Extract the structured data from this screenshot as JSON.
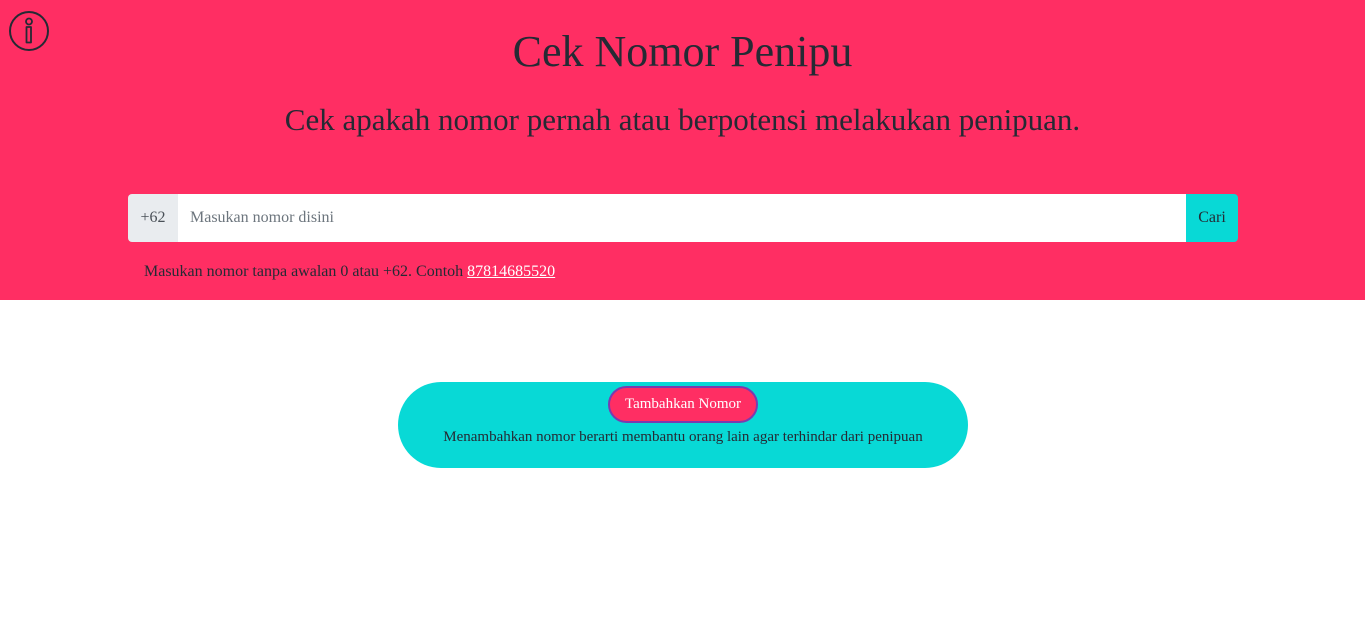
{
  "header": {
    "title": "Cek Nomor Penipu",
    "subtitle": "Cek apakah nomor pernah atau berpotensi melakukan penipuan.",
    "info_icon": "info-icon"
  },
  "search": {
    "prefix": "+62",
    "placeholder": "Masukan nomor disini",
    "value": "",
    "button_label": "Cari"
  },
  "hint": {
    "text": "Masukan nomor tanpa awalan 0 atau +62. Contoh ",
    "example_link": "87814685520"
  },
  "add_section": {
    "button_label": "Tambahkan Nomor",
    "caption": "Menambahkan nomor berarti membantu orang lain agar terhindar dari penipuan"
  },
  "colors": {
    "hero_background": "#ff2e63",
    "accent_cyan": "#08d9d6",
    "text_dark": "#252a34"
  }
}
